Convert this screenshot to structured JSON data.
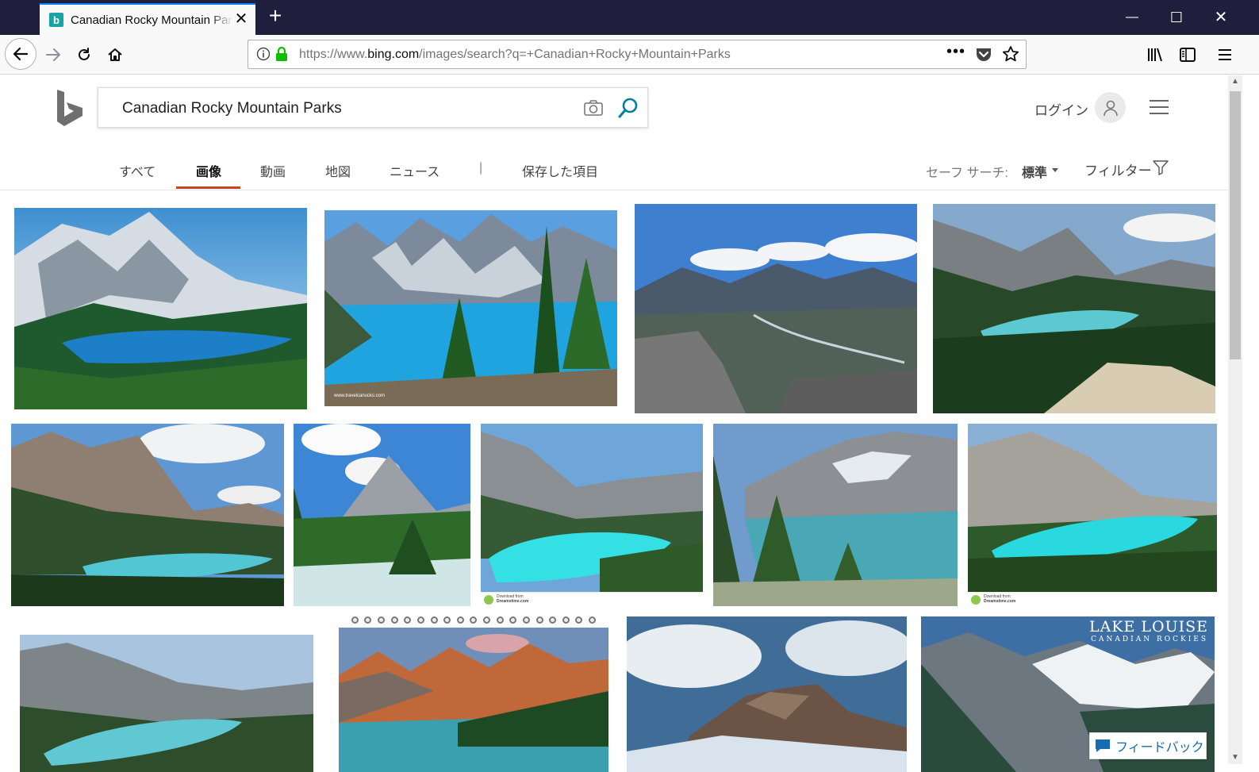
{
  "browser": {
    "tab_title": "Canadian Rocky Mountain Parks",
    "url_prefix": "https://www.",
    "url_host": "bing.com",
    "url_path": "/images/search?q=+Canadian+Rocky+Mountain+Parks",
    "url_more": "•••",
    "new_tab_glyph": "+",
    "close_glyph": "✕",
    "window_minimize": "—",
    "window_maximize": "☐",
    "window_close": "✕",
    "accent_color": "#0a84ff"
  },
  "bing": {
    "search_query": "Canadian Rocky Mountain Parks",
    "login_label": "ログイン",
    "brand_color": "#00809d"
  },
  "scopes": [
    {
      "label": "すべて",
      "active": false
    },
    {
      "label": "画像",
      "active": true
    },
    {
      "label": "動画",
      "active": false
    },
    {
      "label": "地図",
      "active": false
    },
    {
      "label": "ニュース",
      "active": false
    },
    {
      "label": "|",
      "active": false
    },
    {
      "label": "保存した項目",
      "active": false
    }
  ],
  "safe_search": {
    "label": "セーフ サーチ:",
    "value": "標準"
  },
  "filter_label": "フィルター",
  "images": {
    "img2_watermark": "www.travelcanucks.com",
    "dreamstime_line1": "Download from",
    "dreamstime_line2": "Dreamstime.com",
    "lake_louise_title": "LAKE LOUISE",
    "lake_louise_subtitle": "CANADIAN ROCKIES"
  },
  "feedback_label": "フィードバック",
  "icons": [
    "back-arrow-icon",
    "forward-arrow-icon",
    "reload-icon",
    "home-icon",
    "info-icon",
    "lock-icon",
    "pocket-icon",
    "star-icon",
    "library-icon",
    "sidebar-icon",
    "menu-icon",
    "camera-icon",
    "search-icon",
    "user-icon",
    "hamburger-icon",
    "filter-icon",
    "feedback-icon"
  ]
}
